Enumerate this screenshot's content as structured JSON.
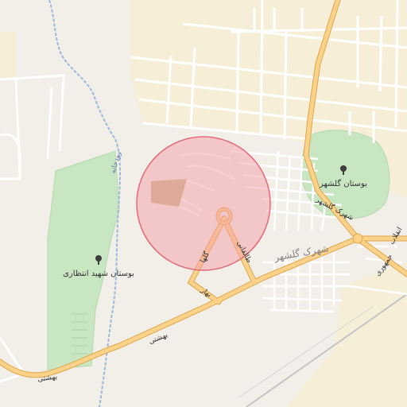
{
  "map": {
    "colors": {
      "land": "#f2efe9",
      "residential": "#f6eed7",
      "park": "#c8e6c1",
      "primary_road": "#fbd28a",
      "primary_road_casing": "#e0a64b",
      "minor_road": "#ffffff",
      "stream": "#9cb8dc",
      "railway": "#b9b9b9",
      "marker_fill": "#f4a0a8",
      "marker_stroke": "#e36a78",
      "building": "#c9b48c"
    },
    "labels": {
      "park_east": "بوستان گلشهر",
      "park_west": "بوستان شهید انتظاری",
      "district": "شهرک گلشهر",
      "district_small": "شهرک گلشهر",
      "road_beheshti_1": "بهشتی",
      "road_beheshti_2": "بهشتی",
      "road_bahar": "بهار",
      "road_golha": "گلها",
      "road_talaghani": "طالقانی",
      "road_jomhouri": "جمهوری",
      "road_enghelab": "انقلاب",
      "stream": "رودخانه"
    },
    "icons": [
      "tree-icon",
      "tree-icon",
      "marker-circle"
    ]
  }
}
